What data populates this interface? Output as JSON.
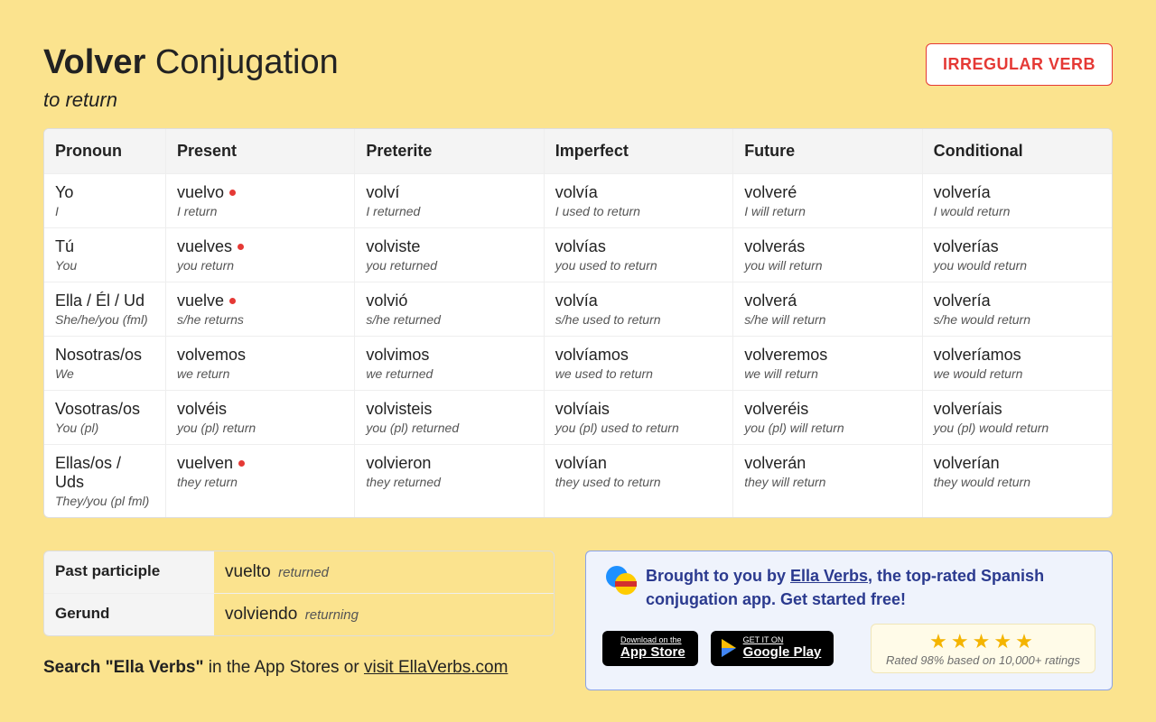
{
  "header": {
    "verb": "Volver",
    "suffix": " Conjugation",
    "translation": "to return",
    "badge": "IRREGULAR VERB"
  },
  "columns": [
    "Pronoun",
    "Present",
    "Preterite",
    "Imperfect",
    "Future",
    "Conditional"
  ],
  "irregular_mark": [
    [
      1
    ],
    [
      1
    ],
    [
      1
    ],
    [],
    [],
    [
      1
    ]
  ],
  "rows": [
    {
      "main": [
        "Yo",
        "vuelvo",
        "volví",
        "volvía",
        "volveré",
        "volvería"
      ],
      "sub": [
        "I",
        "I return",
        "I returned",
        "I used to return",
        "I will return",
        "I would return"
      ]
    },
    {
      "main": [
        "Tú",
        "vuelves",
        "volviste",
        "volvías",
        "volverás",
        "volverías"
      ],
      "sub": [
        "You",
        "you return",
        "you returned",
        "you used to return",
        "you will return",
        "you would return"
      ]
    },
    {
      "main": [
        "Ella / Él / Ud",
        "vuelve",
        "volvió",
        "volvía",
        "volverá",
        "volvería"
      ],
      "sub": [
        "She/he/you (fml)",
        "s/he returns",
        "s/he returned",
        "s/he used to return",
        "s/he will return",
        "s/he would return"
      ]
    },
    {
      "main": [
        "Nosotras/os",
        "volvemos",
        "volvimos",
        "volvíamos",
        "volveremos",
        "volveríamos"
      ],
      "sub": [
        "We",
        "we return",
        "we returned",
        "we used to return",
        "we will return",
        "we would return"
      ]
    },
    {
      "main": [
        "Vosotras/os",
        "volvéis",
        "volvisteis",
        "volvíais",
        "volveréis",
        "volveríais"
      ],
      "sub": [
        "You (pl)",
        "you (pl) return",
        "you (pl) returned",
        "you (pl) used to return",
        "you (pl) will return",
        "you (pl) would return"
      ]
    },
    {
      "main": [
        "Ellas/os / Uds",
        "vuelven",
        "volvieron",
        "volvían",
        "volverán",
        "volverían"
      ],
      "sub": [
        "They/you (pl fml)",
        "they return",
        "they returned",
        "they used to return",
        "they will return",
        "they would return"
      ]
    }
  ],
  "parts": {
    "pp_label": "Past participle",
    "pp_value": "vuelto",
    "pp_trans": "returned",
    "ger_label": "Gerund",
    "ger_value": "volviendo",
    "ger_trans": "returning"
  },
  "search": {
    "bold": "Search \"Ella Verbs\"",
    "rest": " in the App Stores or ",
    "link": "visit EllaVerbs.com"
  },
  "promo": {
    "before": "Brought to you by ",
    "link": "Ella Verbs",
    "after": ", the top-rated Spanish conjugation app. Get started free!",
    "appstore_small": "Download on the",
    "appstore_big": "App Store",
    "gplay_small": "GET IT ON",
    "gplay_big": "Google Play",
    "rating_text": "Rated 98% based on 10,000+ ratings"
  }
}
